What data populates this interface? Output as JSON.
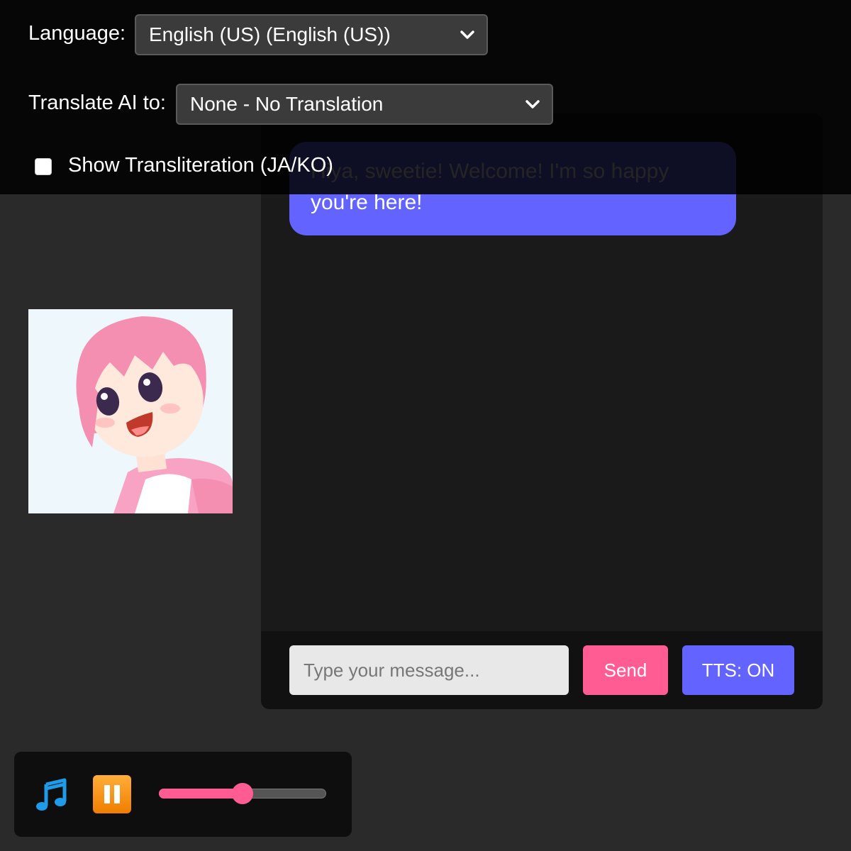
{
  "settings": {
    "language_label": "Language:",
    "language_value": "English (US) (English (US))",
    "translate_label": "Translate AI to:",
    "translate_value": "None - No Translation",
    "transliteration_label": "Show Transliteration (JA/KO)",
    "transliteration_checked": false
  },
  "chat": {
    "messages": [
      {
        "sender": "ai",
        "text": "Hiya, sweetie! Welcome! I'm so happy you're here!"
      }
    ],
    "input_placeholder": "Type your message...",
    "send_label": "Send",
    "tts_label": "TTS: ON"
  },
  "avatar": {
    "icon": "anime-character-portrait",
    "hair_color": "#f48fb1"
  },
  "music_player": {
    "music_icon": "musical-notes-icon",
    "pause_icon": "pause-icon",
    "volume": 0.5
  },
  "colors": {
    "accent_purple": "#6363ff",
    "accent_pink": "#ff5c93",
    "pause_orange": "#f5900f"
  }
}
